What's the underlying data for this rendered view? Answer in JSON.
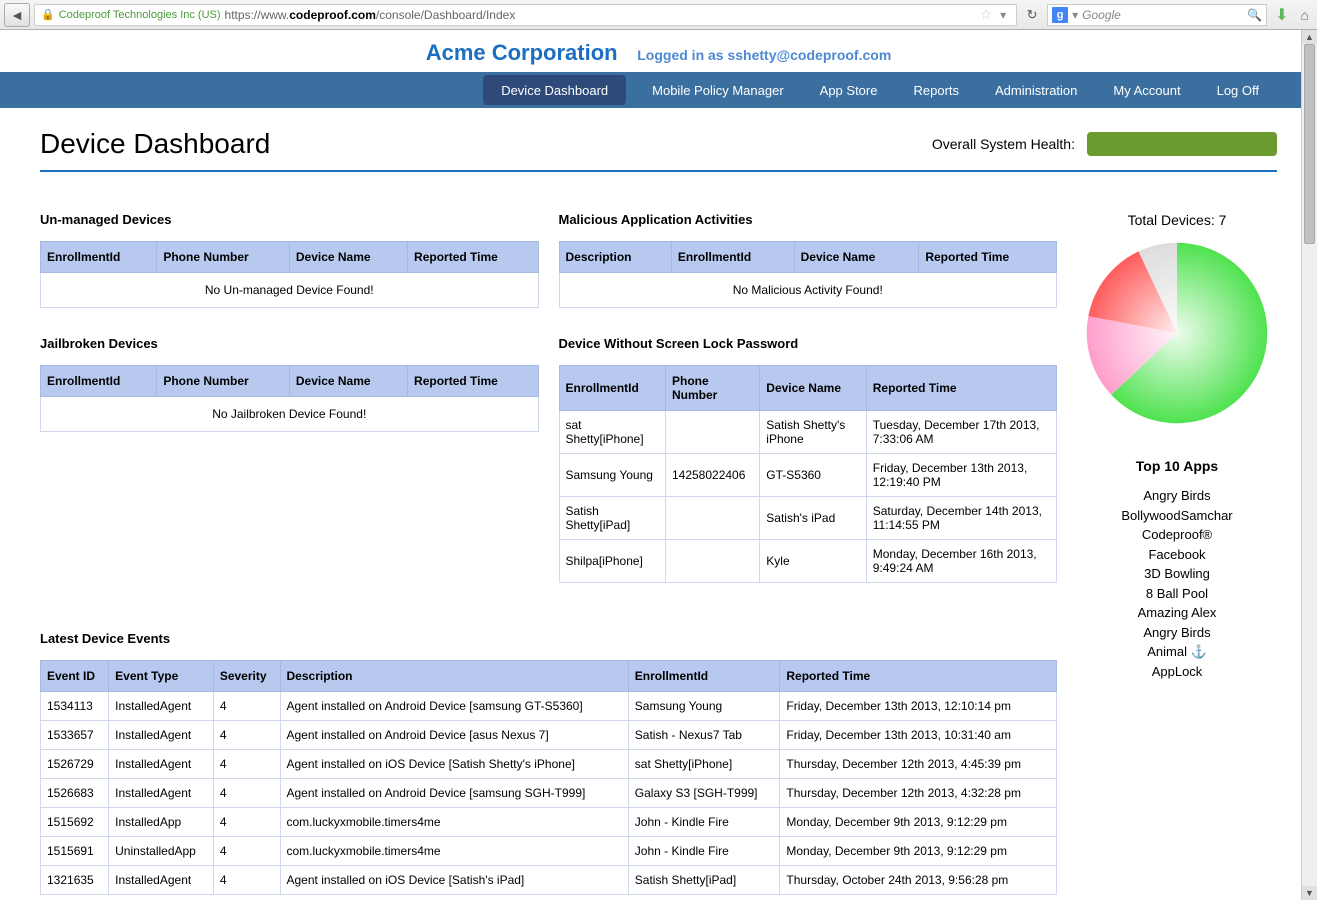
{
  "browser": {
    "cert": "Codeproof Technologies Inc (US)",
    "url_prefix": "https://www.",
    "url_bold": "codeproof.com",
    "url_suffix": "/console/Dashboard/Index",
    "search_placeholder": "Google"
  },
  "header": {
    "company": "Acme Corporation",
    "logged_in": "Logged in as sshetty@codeproof.com"
  },
  "nav": {
    "items": [
      {
        "label": "Device Dashboard",
        "active": true
      },
      {
        "label": "Mobile Policy Manager",
        "active": false
      },
      {
        "label": "App Store",
        "active": false
      },
      {
        "label": "Reports",
        "active": false
      },
      {
        "label": "Administration",
        "active": false
      },
      {
        "label": "My Account",
        "active": false
      },
      {
        "label": "Log Off",
        "active": false
      }
    ]
  },
  "page_title": "Device Dashboard",
  "health_label": "Overall System Health:",
  "panels": {
    "unmanaged": {
      "title": "Un-managed Devices",
      "headers": [
        "EnrollmentId",
        "Phone Number",
        "Device Name",
        "Reported Time"
      ],
      "empty": "No Un-managed Device Found!"
    },
    "malicious": {
      "title": "Malicious Application Activities",
      "headers": [
        "Description",
        "EnrollmentId",
        "Device Name",
        "Reported Time"
      ],
      "empty": "No Malicious Activity Found!"
    },
    "jailbroken": {
      "title": "Jailbroken Devices",
      "headers": [
        "EnrollmentId",
        "Phone Number",
        "Device Name",
        "Reported Time"
      ],
      "empty": "No Jailbroken Device Found!"
    },
    "nolock": {
      "title": "Device Without Screen Lock Password",
      "headers": [
        "EnrollmentId",
        "Phone Number",
        "Device Name",
        "Reported Time"
      ],
      "rows": [
        {
          "enrollment": "sat Shetty[iPhone]",
          "phone": "",
          "device": "Satish Shetty's iPhone",
          "time": "Tuesday, December 17th 2013, 7:33:06 AM"
        },
        {
          "enrollment": "Samsung Young",
          "phone": "14258022406",
          "device": "GT-S5360",
          "time": "Friday, December 13th 2013, 12:19:40 PM"
        },
        {
          "enrollment": "Satish Shetty[iPad]",
          "phone": "",
          "device": "Satish's iPad",
          "time": "Saturday, December 14th 2013, 11:14:55 PM"
        },
        {
          "enrollment": "Shilpa[iPhone]",
          "phone": "",
          "device": "Kyle",
          "time": "Monday, December 16th 2013, 9:49:24 AM"
        }
      ]
    },
    "events": {
      "title": "Latest Device Events",
      "headers": [
        "Event ID",
        "Event Type",
        "Severity",
        "Description",
        "EnrollmentId",
        "Reported Time"
      ],
      "rows": [
        {
          "id": "1534113",
          "type": "InstalledAgent",
          "sev": "4",
          "desc": "Agent installed on Android Device [samsung GT-S5360]",
          "enrollment": "Samsung Young",
          "time": "Friday, December 13th 2013, 12:10:14 pm"
        },
        {
          "id": "1533657",
          "type": "InstalledAgent",
          "sev": "4",
          "desc": "Agent installed on Android Device [asus Nexus 7]",
          "enrollment": "Satish - Nexus7 Tab",
          "time": "Friday, December 13th 2013, 10:31:40 am"
        },
        {
          "id": "1526729",
          "type": "InstalledAgent",
          "sev": "4",
          "desc": "Agent installed on iOS Device [Satish Shetty's iPhone]",
          "enrollment": "sat Shetty[iPhone]",
          "time": "Thursday, December 12th 2013, 4:45:39 pm"
        },
        {
          "id": "1526683",
          "type": "InstalledAgent",
          "sev": "4",
          "desc": "Agent installed on Android Device [samsung SGH-T999]",
          "enrollment": "Galaxy S3 [SGH-T999]",
          "time": "Thursday, December 12th 2013, 4:32:28 pm"
        },
        {
          "id": "1515692",
          "type": "InstalledApp",
          "sev": "4",
          "desc": "com.luckyxmobile.timers4me",
          "enrollment": "John - Kindle Fire",
          "time": "Monday, December 9th 2013, 9:12:29 pm"
        },
        {
          "id": "1515691",
          "type": "UninstalledApp",
          "sev": "4",
          "desc": "com.luckyxmobile.timers4me",
          "enrollment": "John - Kindle Fire",
          "time": "Monday, December 9th 2013, 9:12:29 pm"
        },
        {
          "id": "1321635",
          "type": "InstalledAgent",
          "sev": "4",
          "desc": "Agent installed on iOS Device [Satish's iPad]",
          "enrollment": "Satish Shetty[iPad]",
          "time": "Thursday, October 24th 2013, 9:56:28 pm"
        }
      ]
    }
  },
  "right": {
    "total_devices": "Total Devices: 7",
    "top_apps_title": "Top 10 Apps",
    "apps": [
      "Angry Birds",
      "BollywoodSamchar",
      "Codeproof®",
      "Facebook",
      "3D Bowling",
      "8 Ball Pool",
      "Amazing Alex",
      "Angry Birds",
      "Animal ⚓",
      "AppLock"
    ]
  },
  "chart_data": {
    "type": "pie",
    "title": "Total Devices: 7",
    "series": [
      {
        "name": "green",
        "value": 63,
        "color": "#4fe24f"
      },
      {
        "name": "pink",
        "value": 15,
        "color": "#ff9ecb"
      },
      {
        "name": "red",
        "value": 15,
        "color": "#ff5c5c"
      },
      {
        "name": "gray",
        "value": 7,
        "color": "#dddddd"
      }
    ]
  }
}
